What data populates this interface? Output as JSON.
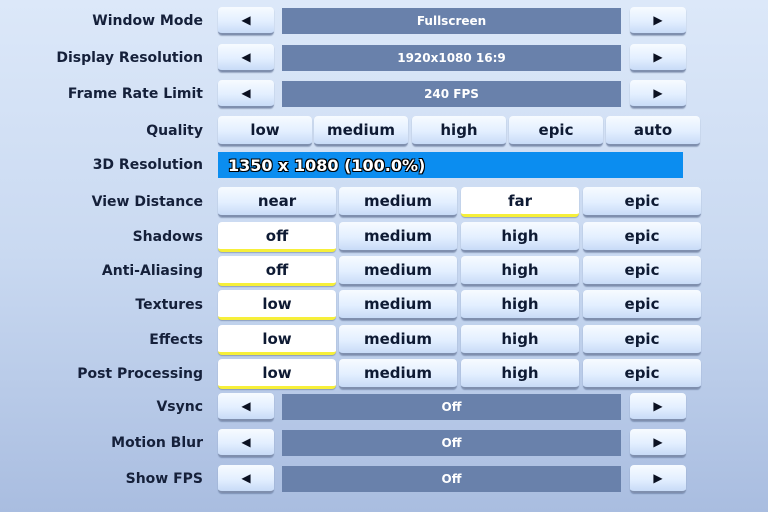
{
  "arrows": {
    "left": "◀",
    "right": "▶"
  },
  "window_mode": {
    "label": "Window Mode",
    "value": "Fullscreen"
  },
  "display_resolution": {
    "label": "Display Resolution",
    "value": "1920x1080 16:9"
  },
  "frame_rate_limit": {
    "label": "Frame Rate Limit",
    "value": "240 FPS"
  },
  "quality": {
    "label": "Quality",
    "options": [
      "low",
      "medium",
      "high",
      "epic",
      "auto"
    ],
    "selected": null
  },
  "resolution_3d": {
    "label": "3D Resolution",
    "value": "1350 x 1080 (100.0%)",
    "percent": 100
  },
  "view_distance": {
    "label": "View Distance",
    "options": [
      "near",
      "medium",
      "far",
      "epic"
    ],
    "selected": "far"
  },
  "shadows": {
    "label": "Shadows",
    "options": [
      "off",
      "medium",
      "high",
      "epic"
    ],
    "selected": "off"
  },
  "anti_aliasing": {
    "label": "Anti-Aliasing",
    "options": [
      "off",
      "medium",
      "high",
      "epic"
    ],
    "selected": "off"
  },
  "textures": {
    "label": "Textures",
    "options": [
      "low",
      "medium",
      "high",
      "epic"
    ],
    "selected": "low"
  },
  "effects": {
    "label": "Effects",
    "options": [
      "low",
      "medium",
      "high",
      "epic"
    ],
    "selected": "low"
  },
  "post_processing": {
    "label": "Post Processing",
    "options": [
      "low",
      "medium",
      "high",
      "epic"
    ],
    "selected": "low"
  },
  "vsync": {
    "label": "Vsync",
    "value": "Off"
  },
  "motion_blur": {
    "label": "Motion Blur",
    "value": "Off"
  },
  "show_fps": {
    "label": "Show FPS",
    "value": "Off"
  },
  "colors": {
    "selected_underline": "#f6ef3a",
    "value_bar": "#6981ab",
    "resolution_bar": "#0b8df0"
  }
}
